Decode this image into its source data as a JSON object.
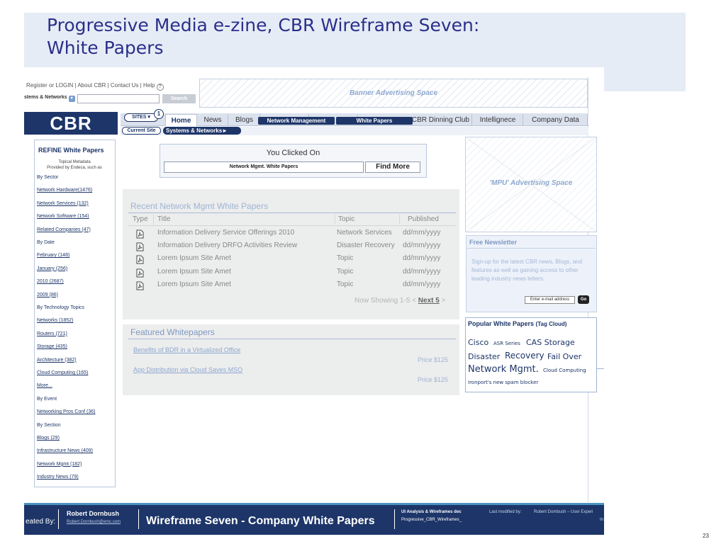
{
  "slide": {
    "title_line1": "Progressive Media e-zine, CBR Wireframe Seven:",
    "title_line2": "White Papers",
    "page_number": "23"
  },
  "utility": {
    "links_text": "Register or LOGIN  |  About CBR  |  Contact Us  |  Help",
    "help_icon": "?",
    "scope_select": "stems & Networks",
    "search_button": "Search",
    "banner": "Banner Advertising Space"
  },
  "logo": "CBR",
  "nav": {
    "sites_label": "SITES ▾",
    "sites_badge": "1",
    "tabs": [
      "Home",
      "News",
      "Blogs",
      "CBR Dinning Club",
      "Intellignece",
      "Company Data"
    ],
    "overlay_active": [
      "Network Management",
      "White Papers"
    ],
    "current_site": "Current Site",
    "systems_networks": "Systems & Networks►"
  },
  "refine": {
    "title": "REFINE White Papers",
    "subtitle_1": "Topical Metadata",
    "subtitle_2": "Provided by Endeca, such as",
    "lines": [
      {
        "text": "By Sector",
        "type": "head"
      },
      {
        "text": "Network Hardware(1476)",
        "type": "link"
      },
      {
        "text": "Network Services (132)",
        "type": "link"
      },
      {
        "text": "Network Software (154)",
        "type": "link"
      },
      {
        "text": "Related Companies (47)",
        "type": "link"
      },
      {
        "text": "By Date",
        "type": "head"
      },
      {
        "text": "February (148)",
        "type": "link"
      },
      {
        "text": "January (256)",
        "type": "link"
      },
      {
        "text": "2010 (2687)",
        "type": "link"
      },
      {
        "text": "2009 (86)",
        "type": "link"
      },
      {
        "text": "By Technology Topics",
        "type": "head"
      },
      {
        "text": "Networks (1852)",
        "type": "link"
      },
      {
        "text": "Routers (721)",
        "type": "link"
      },
      {
        "text": "Storage (435)",
        "type": "link"
      },
      {
        "text": "Architecture (382)",
        "type": "link"
      },
      {
        "text": "Cloud Computing (165)",
        "type": "link"
      },
      {
        "text": "More...",
        "type": "link"
      },
      {
        "text": "By Event",
        "type": "head"
      },
      {
        "text": "Networking Pros Conf (36)",
        "type": "link"
      },
      {
        "text": "By Section",
        "type": "head"
      },
      {
        "text": "Blogs (29)",
        "type": "link"
      },
      {
        "text": "Infrastructure News (409)",
        "type": "link"
      },
      {
        "text": "Network Mgmt (182)",
        "type": "link"
      },
      {
        "text": "Industry News (79)",
        "type": "link"
      }
    ]
  },
  "clicked": {
    "title": "You Clicked On",
    "value": "Network Mgmt. White Papers",
    "button": "Find More"
  },
  "recent": {
    "title": "Recent Network Mgmt White Papers",
    "columns": [
      "Type",
      "Title",
      "Topic",
      "Published"
    ],
    "rows": [
      {
        "type_icon": "pdf-icon",
        "title": "Information Delivery Service Offerings 2010",
        "topic": "Network Services",
        "published": "dd/mm/yyyy"
      },
      {
        "type_icon": "pdf-icon",
        "title": "Information Delivery DRFO Activities Review",
        "topic": "Disaster Recovery",
        "published": "dd/mm/yyyy"
      },
      {
        "type_icon": "pdf-icon",
        "title": "Lorem Ipsum Site Amet",
        "topic": "Topic",
        "published": "dd/mm/yyyy"
      },
      {
        "type_icon": "pdf-icon",
        "title": "Lorem Ipsum Site Amet",
        "topic": "Topic",
        "published": "dd/mm/yyyy"
      },
      {
        "type_icon": "pdf-icon",
        "title": "Lorem Ipsum Site Amet",
        "topic": "Topic",
        "published": "dd/mm/yyyy"
      }
    ],
    "pager_text": "Now Showing 1-5 <",
    "pager_link": "Next 5",
    "pager_end": ">"
  },
  "featured": {
    "title": "Featured Whitepapers",
    "items": [
      {
        "title": "Benefits of BDR in a Virtualized Office",
        "price": "Price $125"
      },
      {
        "title": "App Distribution via Cloud Saves MSO",
        "price": "Price $125"
      }
    ]
  },
  "mpu": "'MPU' Advertising Space",
  "newsletter": {
    "title": "Free Newsletter",
    "body": "Sign-up for the latest CBR news, Blogs, and features as well as gaining access to other leading industry news letters.",
    "placeholder": "Enter e-mail address",
    "go": "Go"
  },
  "popular": {
    "title": "Popular White Papers",
    "title_suffix": "(Tag Cloud)",
    "tags": [
      "Cisco",
      "ASR Series",
      "CAS Storage",
      "Disaster",
      "Recovery",
      "Fail Over",
      "Network Mgmt.",
      "Cloud Computing",
      "Ironport's new spam blocker"
    ]
  },
  "footer": {
    "created_by": "eated By:",
    "author_name": "Robert Dornbush",
    "author_email": "Robert.Dornbush@emc.com",
    "center_title": "Wireframe Seven - Company White Papers",
    "doc_title": "UI Analysis & Wireframes doc",
    "doc_file": "Progressive_CBR_Wireframes_",
    "last_modified_label": "Last modified by:",
    "last_modified_value": "Robert Dombush – User Experi",
    "trailing": "In"
  }
}
